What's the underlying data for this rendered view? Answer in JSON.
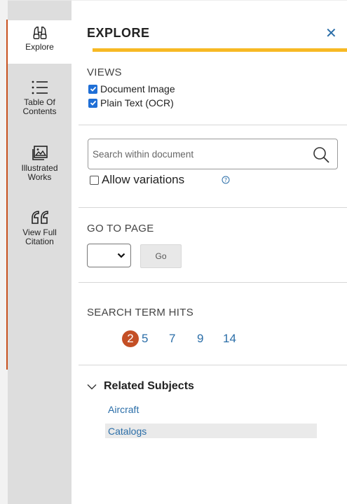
{
  "rail": {
    "items": [
      {
        "label": "Explore",
        "icon": "binoculars-icon",
        "active": true
      },
      {
        "label": "Table Of\nContents",
        "icon": "list-icon",
        "active": false
      },
      {
        "label": "Illustrated\nWorks",
        "icon": "image-icon",
        "active": false
      },
      {
        "label": "View Full\nCitation",
        "icon": "quote-icon",
        "active": false
      }
    ]
  },
  "panel": {
    "title": "EXPLORE",
    "close": "✕"
  },
  "views": {
    "heading": "VIEWS",
    "options": [
      {
        "label": "Document Image",
        "checked": true
      },
      {
        "label": "Plain Text (OCR)",
        "checked": true
      }
    ]
  },
  "search": {
    "placeholder": "Search within document",
    "value": "",
    "allow_variations_label": "Allow variations",
    "allow_variations_checked": false
  },
  "goto": {
    "heading": "GO TO PAGE",
    "selected": "",
    "go_label": "Go"
  },
  "hits": {
    "heading": "SEARCH TERM HITS",
    "items": [
      "2",
      "5",
      "7",
      "9",
      "14"
    ],
    "current": "2"
  },
  "related": {
    "heading": "Related Subjects",
    "subjects": [
      "Aircraft",
      "Catalogs"
    ]
  },
  "colors": {
    "accent_bar": "#f7b924",
    "link": "#2b6ea8",
    "current_hit": "#c44f25",
    "checkbox": "#1f6fd6",
    "rail_bg": "#dddddd"
  }
}
